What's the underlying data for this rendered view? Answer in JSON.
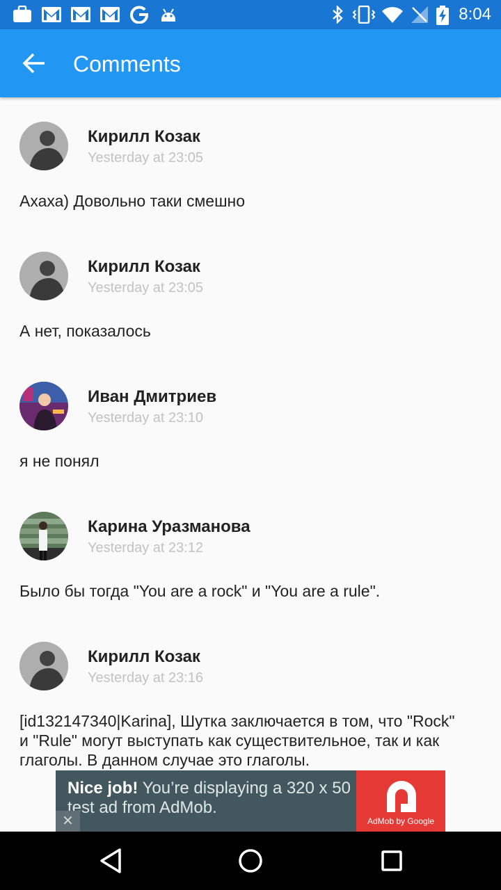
{
  "status_bar": {
    "time": "8:04",
    "icons_left": [
      "briefcase-icon",
      "gmail-icon",
      "gmail-icon",
      "gmail-icon",
      "google-icon",
      "android-icon"
    ],
    "icons_right": [
      "bluetooth-icon",
      "vibrate-icon",
      "wifi-icon",
      "no-signal-icon",
      "battery-charging-icon"
    ]
  },
  "app_bar": {
    "title": "Comments",
    "back_icon": "arrow-back-icon"
  },
  "comments": [
    {
      "author": "Кирилл Козак",
      "time": "Yesterday at 23:05",
      "text": "Ахаха) Довольно таки смешно"
    },
    {
      "author": "Кирилл Козак",
      "time": "Yesterday at 23:05",
      "text": "А нет, показалось"
    },
    {
      "author": "Иван Дмитриев",
      "time": "Yesterday at 23:10",
      "text": "я не понял"
    },
    {
      "author": "Карина Уразманова",
      "time": "Yesterday at 23:12",
      "text": "Было бы тогда \"You are a rock\" и \"You are a rule\"."
    },
    {
      "author": "Кирилл Козак",
      "time": "Yesterday at 23:16",
      "text": "[id132147340|Karina], Шутка заключается в том, что \"Rock\" и \"Rule\" могут выступать как существительное, так и как глаголы. В данном случае это глаголы."
    }
  ],
  "ad": {
    "headline": "Nice job!",
    "body": " You’re displaying a 320 x 50 test ad from AdMob.",
    "brand": "AdMob by Google",
    "close_symbol": "✕",
    "bg_color": "#43575f",
    "logo_bg_color": "#e53935"
  },
  "nav_bar": {
    "buttons": [
      "back-triangle-icon",
      "home-circle-icon",
      "recents-square-icon"
    ]
  },
  "colors": {
    "status_bar": "#1976d2",
    "app_bar": "#2196f3",
    "background": "#fafafa"
  }
}
